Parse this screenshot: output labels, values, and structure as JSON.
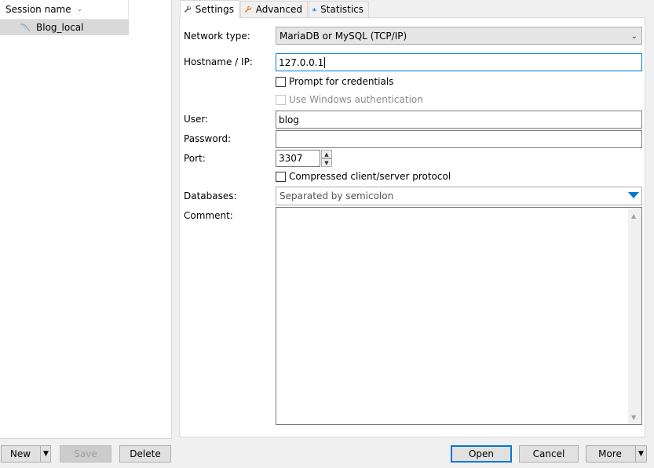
{
  "session_tree": {
    "header": "Session name",
    "items": [
      {
        "label": "Blog_local"
      }
    ]
  },
  "left_buttons": {
    "new": "New",
    "save": "Save",
    "delete": "Delete"
  },
  "tabs": [
    {
      "label": "Settings",
      "icon": "wrench-icon"
    },
    {
      "label": "Advanced",
      "icon": "wrench-orange-icon"
    },
    {
      "label": "Statistics",
      "icon": "bar-chart-icon"
    }
  ],
  "form": {
    "network_type_label": "Network type:",
    "network_type_value": "MariaDB or MySQL (TCP/IP)",
    "hostname_label": "Hostname / IP:",
    "hostname_value": "127.0.0.1",
    "prompt_credentials": "Prompt for credentials",
    "windows_auth": "Use Windows authentication",
    "user_label": "User:",
    "user_value": "blog",
    "password_label": "Password:",
    "password_value": "",
    "port_label": "Port:",
    "port_value": "3307",
    "compressed_protocol": "Compressed client/server protocol",
    "databases_label": "Databases:",
    "databases_placeholder": "Separated by semicolon",
    "comment_label": "Comment:",
    "comment_value": ""
  },
  "right_buttons": {
    "open": "Open",
    "cancel": "Cancel",
    "more": "More"
  },
  "colors": {
    "accent": "#0078d7",
    "selected_row": "#d9d9d9"
  }
}
